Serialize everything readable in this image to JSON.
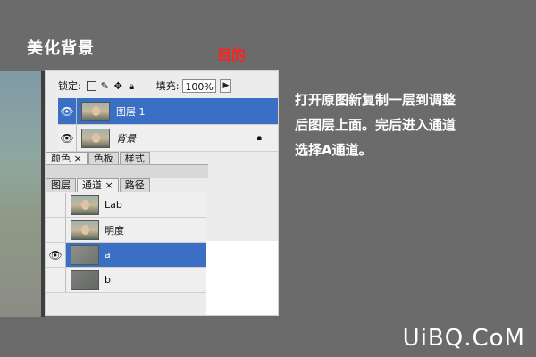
{
  "section_title": "美化背景",
  "goal_label": "目的",
  "layers_panel": {
    "lock_label": "锁定:",
    "fill_label": "填充:",
    "fill_value": "100%",
    "layers": [
      {
        "name": "图层 1",
        "selected": true
      },
      {
        "name": "背景",
        "selected": false,
        "locked": true
      }
    ]
  },
  "mid_tabs": [
    "颜色",
    "色板",
    "样式"
  ],
  "channels_panel": {
    "tabs": [
      "图层",
      "通道",
      "路径"
    ],
    "channels": [
      {
        "name": "Lab",
        "visible": false
      },
      {
        "name": "明度",
        "visible": false
      },
      {
        "name": "a",
        "visible": true,
        "selected": true
      },
      {
        "name": "b",
        "visible": false
      }
    ]
  },
  "instructions": [
    "打开原图新复制一层到调整",
    "后图层上面。完后进入通道",
    "选择A通道。"
  ],
  "brand": "UiBQ.CoM",
  "colors": {
    "selection": "#3a6fc4",
    "goal_red": "#ff2020",
    "background": "#6b6b6b"
  }
}
